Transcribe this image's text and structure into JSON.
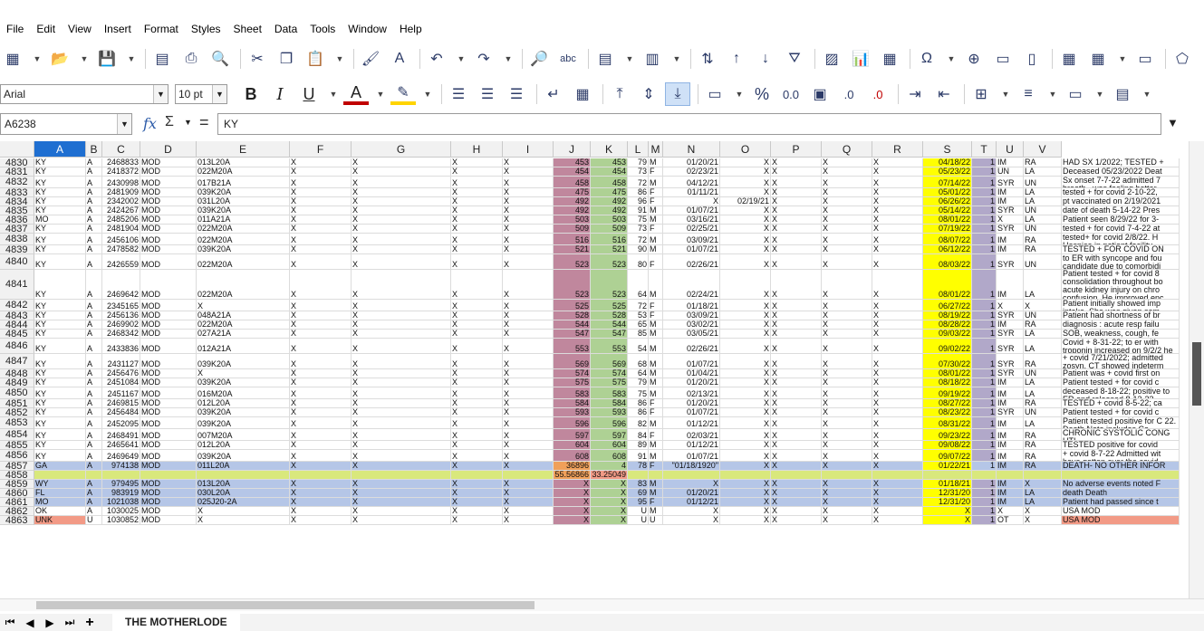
{
  "menu": [
    "File",
    "Edit",
    "View",
    "Insert",
    "Format",
    "Styles",
    "Sheet",
    "Data",
    "Tools",
    "Window",
    "Help"
  ],
  "toolbar1_icons": [
    "new-spreadsheet-icon",
    "open-icon",
    "save-icon",
    "export-pdf-icon",
    "print-icon",
    "print-preview-icon",
    "cut-icon",
    "copy-icon",
    "paste-icon",
    "clone-formatting-icon",
    "clear-formatting-icon",
    "undo-icon",
    "redo-icon",
    "find-replace-icon",
    "spelling-icon",
    "row-icon",
    "column-icon",
    "sort-icon",
    "sort-ascending-icon",
    "sort-descending-icon",
    "autofilter-icon",
    "image-icon",
    "chart-icon",
    "pivot-table-icon",
    "special-character-icon",
    "hyperlink-icon",
    "comment-icon",
    "header-footer-icon",
    "define-print-area-icon",
    "freeze-rows-columns-icon",
    "split-window-icon",
    "show-draw-functions-icon"
  ],
  "font": {
    "name": "Arial",
    "size": "10 pt"
  },
  "toolbar2_glyphs": {
    "bold": "B",
    "italic": "I",
    "underline": "U",
    "font_color": "A",
    "percent": "%",
    "number": "0.0",
    "add_decimal": ".0",
    "delete_decimal": ".0"
  },
  "formula": {
    "cell_ref": "A6238",
    "value": "KY",
    "fx": "fx",
    "sigma": "Σ",
    "equals": "="
  },
  "columns": [
    "A",
    "B",
    "C",
    "D",
    "E",
    "F",
    "G",
    "H",
    "I",
    "J",
    "K",
    "L",
    "M",
    "N",
    "O",
    "P",
    "Q",
    "R",
    "S",
    "T",
    "U",
    "V"
  ],
  "rows": [
    {
      "n": "4830",
      "A": "KY",
      "B": "A",
      "C": "2468833",
      "D": "MOD",
      "E": "013L20A",
      "F": "X",
      "G": "X",
      "H": "X",
      "I": "X",
      "J": "453",
      "K": "453",
      "L": "79",
      "M": "M",
      "N": "01/20/21",
      "O": "X",
      "P": "X",
      "Q": "X",
      "R": "X",
      "S": "04/18/22",
      "T": "1",
      "U": "IM",
      "V": "RA",
      "W": "HAD SX 1/2022; TESTED + ACUTE ON CHRONIC CHF;"
    },
    {
      "n": "4831",
      "A": "KY",
      "B": "A",
      "C": "2418372",
      "D": "MOD",
      "E": "022M20A",
      "F": "X",
      "G": "X",
      "H": "X",
      "I": "X",
      "J": "454",
      "K": "454",
      "L": "73",
      "M": "F",
      "N": "02/23/21",
      "O": "X",
      "P": "X",
      "Q": "X",
      "R": "X",
      "S": "05/23/22",
      "T": "1",
      "U": "UN",
      "V": "LA",
      "W": "Deceased 05/23/2022 Deat"
    },
    {
      "n": "4832",
      "A": "KY",
      "B": "A",
      "C": "2430998",
      "D": "MOD",
      "E": "017B21A",
      "F": "X",
      "G": "X",
      "H": "X",
      "I": "X",
      "J": "458",
      "K": "458",
      "L": "72",
      "M": "M",
      "N": "04/12/21",
      "O": "X",
      "P": "X",
      "Q": "X",
      "R": "X",
      "S": "07/14/22",
      "T": "1",
      "U": "SYR",
      "V": "UN",
      "W": "Sx onset 7-7-22 admitted 7 breath . was feeling better"
    },
    {
      "n": "4833",
      "A": "KY",
      "B": "A",
      "C": "2481909",
      "D": "MOD",
      "E": "039K20A",
      "F": "X",
      "G": "X",
      "H": "X",
      "I": "X",
      "J": "475",
      "K": "475",
      "L": "86",
      "M": "F",
      "N": "01/11/21",
      "O": "X",
      "P": "X",
      "Q": "X",
      "R": "X",
      "S": "05/01/22",
      "T": "1",
      "U": "IM",
      "V": "LA",
      "W": "tested + for covid 2-10-22,"
    },
    {
      "n": "4834",
      "A": "KY",
      "B": "A",
      "C": "2342002",
      "D": "MOD",
      "E": "031L20A",
      "F": "X",
      "G": "X",
      "H": "X",
      "I": "X",
      "J": "492",
      "K": "492",
      "L": "96",
      "M": "F",
      "N": "X",
      "O": "02/19/21",
      "P": "X",
      "Q": "X",
      "R": "X",
      "S": "06/26/22",
      "T": "1",
      "U": "IM",
      "V": "LA",
      "W": "pt vaccinated on 2/19/2021"
    },
    {
      "n": "4835",
      "A": "KY",
      "B": "A",
      "C": "2424267",
      "D": "MOD",
      "E": "039K20A",
      "F": "X",
      "G": "X",
      "H": "X",
      "I": "X",
      "J": "492",
      "K": "492",
      "L": "91",
      "M": "M",
      "N": "01/07/21",
      "O": "X",
      "P": "X",
      "Q": "X",
      "R": "X",
      "S": "05/14/22",
      "T": "1",
      "U": "SYR",
      "V": "UN",
      "W": "date of death 5-14-22 Pres"
    },
    {
      "n": "4836",
      "A": "MO",
      "B": "A",
      "C": "2485206",
      "D": "MOD",
      "E": "011A21A",
      "F": "X",
      "G": "X",
      "H": "X",
      "I": "X",
      "J": "503",
      "K": "503",
      "L": "75",
      "M": "M",
      "N": "03/16/21",
      "O": "X",
      "P": "X",
      "Q": "X",
      "R": "X",
      "S": "08/01/22",
      "T": "1",
      "U": "X",
      "V": "LA",
      "W": "Patient seen 8/29/22 for 3-"
    },
    {
      "n": "4837",
      "A": "KY",
      "B": "A",
      "C": "2481904",
      "D": "MOD",
      "E": "022M20A",
      "F": "X",
      "G": "X",
      "H": "X",
      "I": "X",
      "J": "509",
      "K": "509",
      "L": "73",
      "M": "F",
      "N": "02/25/21",
      "O": "X",
      "P": "X",
      "Q": "X",
      "R": "X",
      "S": "07/19/22",
      "T": "1",
      "U": "SYR",
      "V": "UN",
      "W": "tested + for covid 7-4-22 at"
    },
    {
      "n": "4838",
      "A": "KY",
      "B": "A",
      "C": "2456106",
      "D": "MOD",
      "E": "022M20A",
      "F": "X",
      "G": "X",
      "H": "X",
      "I": "X",
      "J": "516",
      "K": "516",
      "L": "72",
      "M": "M",
      "N": "03/09/21",
      "O": "X",
      "P": "X",
      "Q": "X",
      "R": "X",
      "S": "08/07/22",
      "T": "1",
      "U": "IM",
      "V": "RA",
      "W": "tested+ for covid 2/8/22. H Hospice in patient facility."
    },
    {
      "n": "4839",
      "A": "KY",
      "B": "A",
      "C": "2478582",
      "D": "MOD",
      "E": "039K20A",
      "F": "X",
      "G": "X",
      "H": "X",
      "I": "X",
      "J": "521",
      "K": "521",
      "L": "90",
      "M": "M",
      "N": "01/07/21",
      "O": "X",
      "P": "X",
      "Q": "X",
      "R": "X",
      "S": "06/12/22",
      "T": "1",
      "U": "IM",
      "V": "RA",
      "W": "TESTED + FOR COVID ON"
    },
    {
      "n": "4840",
      "A": "KY",
      "B": "A",
      "C": "2426559",
      "D": "MOD",
      "E": "022M20A",
      "F": "X",
      "G": "X",
      "H": "X",
      "I": "X",
      "J": "523",
      "K": "523",
      "L": "80",
      "M": "F",
      "N": "02/26/21",
      "O": "X",
      "P": "X",
      "Q": "X",
      "R": "X",
      "S": "08/03/22",
      "T": "1",
      "U": "SYR",
      "V": "UN",
      "W": "to ER with syncope and fou candidate due to comorbidi"
    },
    {
      "n": "4841",
      "A": "KY",
      "B": "A",
      "C": "2469642",
      "D": "MOD",
      "E": "022M20A",
      "F": "X",
      "G": "X",
      "H": "X",
      "I": "X",
      "J": "523",
      "K": "523",
      "L": "64",
      "M": "M",
      "N": "02/24/21",
      "O": "X",
      "P": "X",
      "Q": "X",
      "R": "X",
      "S": "08/01/22",
      "T": "1",
      "U": "IM",
      "V": "LA",
      "W": "Patient tested + for covid 8 consolidation throughout bo acute kidney injury on chro confusion. He improved enc"
    },
    {
      "n": "4842",
      "A": "KY",
      "B": "A",
      "C": "2345165",
      "D": "MOD",
      "E": "X",
      "F": "X",
      "G": "X",
      "H": "X",
      "I": "X",
      "J": "525",
      "K": "525",
      "L": "72",
      "M": "F",
      "N": "01/18/21",
      "O": "X",
      "P": "X",
      "Q": "X",
      "R": "X",
      "S": "06/27/22",
      "T": "1",
      "U": "X",
      "V": "X",
      "W": "Patient initially showed imp intake. She was given som"
    },
    {
      "n": "4843",
      "A": "KY",
      "B": "A",
      "C": "2456136",
      "D": "MOD",
      "E": "048A21A",
      "F": "X",
      "G": "X",
      "H": "X",
      "I": "X",
      "J": "528",
      "K": "528",
      "L": "53",
      "M": "F",
      "N": "03/09/21",
      "O": "X",
      "P": "X",
      "Q": "X",
      "R": "X",
      "S": "08/19/22",
      "T": "1",
      "U": "SYR",
      "V": "UN",
      "W": "Patient had shortness of br"
    },
    {
      "n": "4844",
      "A": "KY",
      "B": "A",
      "C": "2469902",
      "D": "MOD",
      "E": "022M20A",
      "F": "X",
      "G": "X",
      "H": "X",
      "I": "X",
      "J": "544",
      "K": "544",
      "L": "65",
      "M": "M",
      "N": "03/02/21",
      "O": "X",
      "P": "X",
      "Q": "X",
      "R": "X",
      "S": "08/28/22",
      "T": "1",
      "U": "IM",
      "V": "RA",
      "W": "diagnosis : acute resp failu"
    },
    {
      "n": "4845",
      "A": "KY",
      "B": "A",
      "C": "2468342",
      "D": "MOD",
      "E": "027A21A",
      "F": "X",
      "G": "X",
      "H": "X",
      "I": "X",
      "J": "547",
      "K": "547",
      "L": "85",
      "M": "M",
      "N": "03/05/21",
      "O": "X",
      "P": "X",
      "Q": "X",
      "R": "X",
      "S": "09/03/22",
      "T": "1",
      "U": "SYR",
      "V": "LA",
      "W": "SOB, weakness, cough, fe"
    },
    {
      "n": "4846",
      "A": "KY",
      "B": "A",
      "C": "2433836",
      "D": "MOD",
      "E": "012A21A",
      "F": "X",
      "G": "X",
      "H": "X",
      "I": "X",
      "J": "553",
      "K": "553",
      "L": "54",
      "M": "M",
      "N": "02/26/21",
      "O": "X",
      "P": "X",
      "Q": "X",
      "R": "X",
      "S": "09/02/22",
      "T": "1",
      "U": "SYR",
      "V": "LA",
      "W": "Covid + 8-31-22; to er with troponin increased on 9/2/2 he expired 9/2/22"
    },
    {
      "n": "4847",
      "A": "KY",
      "B": "A",
      "C": "2431127",
      "D": "MOD",
      "E": "039K20A",
      "F": "X",
      "G": "X",
      "H": "X",
      "I": "X",
      "J": "569",
      "K": "569",
      "L": "68",
      "M": "M",
      "N": "01/07/21",
      "O": "X",
      "P": "X",
      "Q": "X",
      "R": "X",
      "S": "07/30/22",
      "T": "1",
      "U": "SYR",
      "V": "RA",
      "W": "+ covid 7/21/2022; admitted zosyn. CT showed indeterm and he had ROSC, placed"
    },
    {
      "n": "4848",
      "A": "KY",
      "B": "A",
      "C": "2456476",
      "D": "MOD",
      "E": "X",
      "F": "X",
      "G": "X",
      "H": "X",
      "I": "X",
      "J": "574",
      "K": "574",
      "L": "64",
      "M": "M",
      "N": "01/04/21",
      "O": "X",
      "P": "X",
      "Q": "X",
      "R": "X",
      "S": "08/01/22",
      "T": "1",
      "U": "SYR",
      "V": "UN",
      "W": "Patient was + covid first on"
    },
    {
      "n": "4849",
      "A": "KY",
      "B": "A",
      "C": "2451084",
      "D": "MOD",
      "E": "039K20A",
      "F": "X",
      "G": "X",
      "H": "X",
      "I": "X",
      "J": "575",
      "K": "575",
      "L": "79",
      "M": "M",
      "N": "01/20/21",
      "O": "X",
      "P": "X",
      "Q": "X",
      "R": "X",
      "S": "08/18/22",
      "T": "1",
      "U": "IM",
      "V": "LA",
      "W": "Patient tested + for covid c"
    },
    {
      "n": "4850",
      "A": "KY",
      "B": "A",
      "C": "2451167",
      "D": "MOD",
      "E": "016M20A",
      "F": "X",
      "G": "X",
      "H": "X",
      "I": "X",
      "J": "583",
      "K": "583",
      "L": "75",
      "M": "M",
      "N": "02/13/21",
      "O": "X",
      "P": "X",
      "Q": "X",
      "R": "X",
      "S": "09/19/22",
      "T": "1",
      "U": "IM",
      "V": "LA",
      "W": "deceased 8-18-22; positive to ER and released 8-13-22"
    },
    {
      "n": "4851",
      "A": "KY",
      "B": "A",
      "C": "2469815",
      "D": "MOD",
      "E": "012L20A",
      "F": "X",
      "G": "X",
      "H": "X",
      "I": "X",
      "J": "584",
      "K": "584",
      "L": "86",
      "M": "F",
      "N": "01/20/21",
      "O": "X",
      "P": "X",
      "Q": "X",
      "R": "X",
      "S": "08/27/22",
      "T": "1",
      "U": "IM",
      "V": "RA",
      "W": "TESTED + covid 8-5-22; ca"
    },
    {
      "n": "4852",
      "A": "KY",
      "B": "A",
      "C": "2456484",
      "D": "MOD",
      "E": "039K20A",
      "F": "X",
      "G": "X",
      "H": "X",
      "I": "X",
      "J": "593",
      "K": "593",
      "L": "86",
      "M": "F",
      "N": "01/07/21",
      "O": "X",
      "P": "X",
      "Q": "X",
      "R": "X",
      "S": "08/23/22",
      "T": "1",
      "U": "SYR",
      "V": "UN",
      "W": "Patient tested + for covid c"
    },
    {
      "n": "4853",
      "A": "KY",
      "B": "A",
      "C": "2452095",
      "D": "MOD",
      "E": "039K20A",
      "F": "X",
      "G": "X",
      "H": "X",
      "I": "X",
      "J": "596",
      "K": "596",
      "L": "82",
      "M": "M",
      "N": "01/12/21",
      "O": "X",
      "P": "X",
      "Q": "X",
      "R": "X",
      "S": "08/31/22",
      "T": "1",
      "U": "IM",
      "V": "LA",
      "W": "Patient tested positive for C 22. Death Note includes Co"
    },
    {
      "n": "4854",
      "A": "KY",
      "B": "A",
      "C": "2468491",
      "D": "MOD",
      "E": "007M20A",
      "F": "X",
      "G": "X",
      "H": "X",
      "I": "X",
      "J": "597",
      "K": "597",
      "L": "84",
      "M": "F",
      "N": "02/03/21",
      "O": "X",
      "P": "X",
      "Q": "X",
      "R": "X",
      "S": "09/23/22",
      "T": "1",
      "U": "IM",
      "V": "RA",
      "W": "CHRONIC SYSTOLIC CONG UTI"
    },
    {
      "n": "4855",
      "A": "KY",
      "B": "A",
      "C": "2465641",
      "D": "MOD",
      "E": "012L20A",
      "F": "X",
      "G": "X",
      "H": "X",
      "I": "X",
      "J": "604",
      "K": "604",
      "L": "89",
      "M": "M",
      "N": "01/12/21",
      "O": "X",
      "P": "X",
      "Q": "X",
      "R": "X",
      "S": "09/08/22",
      "T": "1",
      "U": "IM",
      "V": "RA",
      "W": "TESTED positive for covid"
    },
    {
      "n": "4856",
      "A": "KY",
      "B": "A",
      "C": "2469649",
      "D": "MOD",
      "E": "039K20A",
      "F": "X",
      "G": "X",
      "H": "X",
      "I": "X",
      "J": "608",
      "K": "608",
      "L": "91",
      "M": "M",
      "N": "01/07/21",
      "O": "X",
      "P": "X",
      "Q": "X",
      "R": "X",
      "S": "09/07/22",
      "T": "1",
      "U": "IM",
      "V": "RA",
      "W": "+ covid 8-7-22 Admitted wit have gotten over the covid"
    },
    {
      "n": "4857",
      "A": "GA",
      "B": "A",
      "C": "974138",
      "D": "MOD",
      "E": "011L20A",
      "F": "X",
      "G": "X",
      "H": "X",
      "I": "X",
      "J": "36896",
      "K": "4",
      "L": "78",
      "M": "F",
      "N": "\"01/18/1920\"",
      "O": "X",
      "P": "X",
      "Q": "X",
      "R": "X",
      "S": "01/22/21",
      "T": "1",
      "U": "IM",
      "V": "RA",
      "W": "DEATH- NO OTHER INFOR"
    },
    {
      "n": "4858",
      "A": "",
      "B": "",
      "C": "",
      "D": "",
      "E": "",
      "F": "",
      "G": "",
      "H": "",
      "I": "",
      "J": "55.56866",
      "K": "33.25049",
      "L": "",
      "M": "",
      "N": "",
      "O": "",
      "P": "",
      "Q": "",
      "R": "",
      "S": "",
      "T": "",
      "U": "",
      "V": "",
      "W": ""
    },
    {
      "n": "4859",
      "A": "WY",
      "B": "A",
      "C": "979495",
      "D": "MOD",
      "E": "013L20A",
      "F": "X",
      "G": "X",
      "H": "X",
      "I": "X",
      "J": "X",
      "K": "X",
      "L": "83",
      "M": "M",
      "N": "X",
      "O": "X",
      "P": "X",
      "Q": "X",
      "R": "X",
      "S": "01/18/21",
      "T": "1",
      "U": "IM",
      "V": "X",
      "W": "No adverse events noted F"
    },
    {
      "n": "4860",
      "A": "FL",
      "B": "A",
      "C": "983919",
      "D": "MOD",
      "E": "030L20A",
      "F": "X",
      "G": "X",
      "H": "X",
      "I": "X",
      "J": "X",
      "K": "X",
      "L": "69",
      "M": "M",
      "N": "01/20/21",
      "O": "X",
      "P": "X",
      "Q": "X",
      "R": "X",
      "S": "12/31/20",
      "T": "1",
      "U": "IM",
      "V": "LA",
      "W": "death Death"
    },
    {
      "n": "4861",
      "A": "MO",
      "B": "A",
      "C": "1021038",
      "D": "MOD",
      "E": "025J20-2A",
      "F": "X",
      "G": "X",
      "H": "X",
      "I": "X",
      "J": "X",
      "K": "X",
      "L": "95",
      "M": "F",
      "N": "01/12/21",
      "O": "X",
      "P": "X",
      "Q": "X",
      "R": "X",
      "S": "12/31/20",
      "T": "1",
      "U": "IM",
      "V": "LA",
      "W": "Patient had passed since t"
    },
    {
      "n": "4862",
      "A": "OK",
      "B": "A",
      "C": "1030025",
      "D": "MOD",
      "E": "X",
      "F": "X",
      "G": "X",
      "H": "X",
      "I": "X",
      "J": "X",
      "K": "X",
      "L": "U",
      "M": "M",
      "N": "X",
      "O": "X",
      "P": "X",
      "Q": "X",
      "R": "X",
      "S": "X",
      "T": "1",
      "U": "X",
      "V": "X",
      "W": "USA MOD"
    },
    {
      "n": "4863",
      "A": "UNK",
      "B": "U",
      "C": "1030852",
      "D": "MOD",
      "E": "X",
      "F": "X",
      "G": "X",
      "H": "X",
      "I": "X",
      "J": "X",
      "K": "X",
      "L": "U",
      "M": "U",
      "N": "X",
      "O": "X",
      "P": "X",
      "Q": "X",
      "R": "X",
      "S": "X",
      "T": "1",
      "U": "OT",
      "V": "X",
      "W": "USA MOD"
    }
  ],
  "sheet_tab": "THE MOTHERLODE",
  "colors": {
    "J": "#c0879d",
    "K": "#aed194",
    "S": "#ffff00",
    "T": "#b1a8c9",
    "blue_row": "#b5c6e7",
    "green_row": "#d9e87c",
    "orange": "#f0a05a",
    "salmon": "#f29a86"
  }
}
